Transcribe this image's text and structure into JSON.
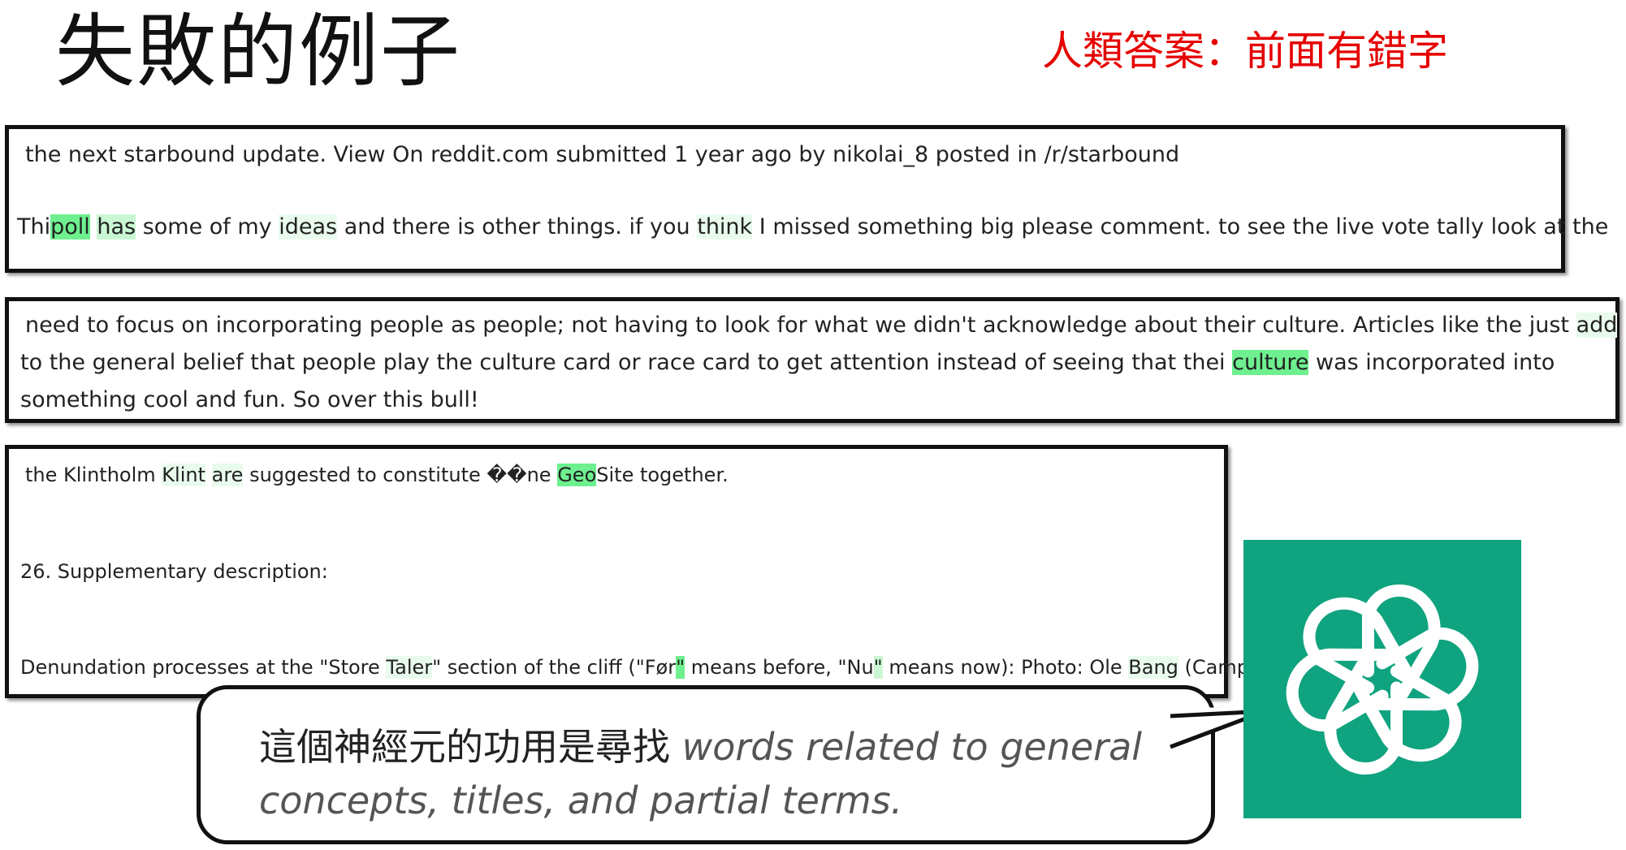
{
  "title": "失敗的例子",
  "human_answer": "人類答案：前面有錯字",
  "example1": {
    "line1": "the next starbound update. View On reddit.com submitted 1 year ago by nikolai_8 posted in /r/starbound",
    "line2": {
      "t1": "Thi",
      "t2": "poll",
      "t3": " ",
      "t4": "has",
      "t5": " some of my ",
      "t6": "ideas",
      "t7": " and there is other things. if you ",
      "t8": "think",
      "t9": " I missed something big please comment. to see the live vote tally look at the"
    }
  },
  "example2": {
    "line1": {
      "t1": "need to focus on incorporating people as people; not having to look for what we didn't acknowledge about their culture. Articles like the just ",
      "t2": "add"
    },
    "line2": {
      "t1": "to the general belief that people play the culture card or race card to get attention instead of seeing that thei ",
      "t2": "culture",
      "t3": " was incorporated into"
    },
    "line3": "something cool and fun. So over this bull!"
  },
  "example3": {
    "line1": {
      "t1": "the Klintholm ",
      "t2": "Klint",
      "t3": " ",
      "t4": "are",
      "t5": " suggested to constitute ��ne ",
      "t6": "Geo",
      "t7": "Site together."
    },
    "line2": "26. Supplementary description:",
    "line3": {
      "t1": "Denundation processes at the \"Store ",
      "t2": "Taler",
      "t3": "\" section of the cliff (\"Før",
      "t4": "\"",
      "t5": " means before, \"Nu",
      "t6": "\"",
      "t7": " means now): Photo: Ole ",
      "t8": "Bang",
      "t9": " (Camp"
    }
  },
  "explanation": {
    "zh": "這個神經元的功用是尋找",
    "en1": "words related to general",
    "en2": "concepts, titles, and partial terms."
  },
  "logo": {
    "name": "openai-logo-icon",
    "background": "#10a37f"
  },
  "colors": {
    "answer": "#e60000",
    "highlight_strong": "#6ef08f",
    "highlight_medium": "#c9f7d3",
    "highlight_light": "#e9fbed"
  }
}
